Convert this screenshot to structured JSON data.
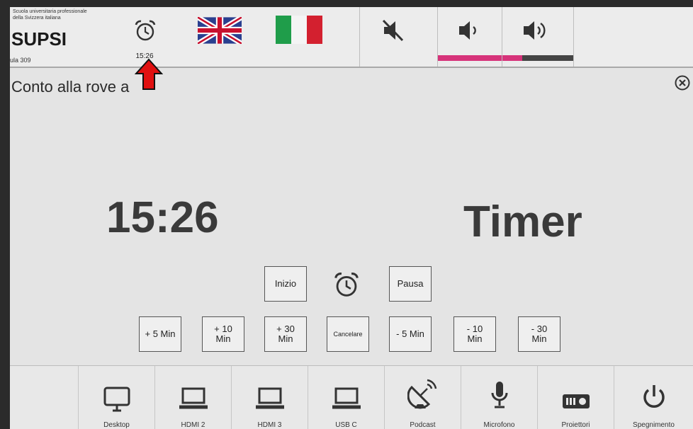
{
  "header": {
    "institution_line1": "Scuola universitaria professionale",
    "institution_line2": "della Svizzera italiana",
    "brand": "SUPSI",
    "room": "ula 309",
    "clock_time": "15:26"
  },
  "languages": [
    "english-flag",
    "italian-flag"
  ],
  "audio": {
    "mute_icon": "speaker-mute-icon",
    "vol_down_icon": "speaker-low-icon",
    "vol_up_icon": "speaker-high-icon",
    "vol_down_color": "#d6337a",
    "vol_up_color": "#444444"
  },
  "page": {
    "title": "Conto alla rove   a",
    "big_time": "15:26",
    "big_label": "Timer"
  },
  "controls": {
    "start": "Inizio",
    "pause": "Pausa",
    "adjust": [
      {
        "l1": "+ 5 Min",
        "l2": ""
      },
      {
        "l1": "+ 10",
        "l2": "Min"
      },
      {
        "l1": "+ 30",
        "l2": "Min"
      },
      {
        "l1": "Cancelare",
        "l2": ""
      },
      {
        "l1": "- 5 Min",
        "l2": ""
      },
      {
        "l1": "- 10",
        "l2": "Min"
      },
      {
        "l1": "- 30",
        "l2": "Min"
      }
    ]
  },
  "sources": [
    {
      "label": "Desktop",
      "icon": "monitor-icon"
    },
    {
      "label": "HDMI 2",
      "icon": "laptop-icon"
    },
    {
      "label": "HDMI 3",
      "icon": "laptop-icon"
    },
    {
      "label": "USB C",
      "icon": "laptop-icon"
    },
    {
      "label": "Podcast",
      "icon": "satellite-dish-icon"
    },
    {
      "label": "Microfono",
      "icon": "microphone-icon"
    },
    {
      "label": "Proiettori",
      "icon": "projector-icon"
    },
    {
      "label": "Spegnimento",
      "icon": "power-icon"
    }
  ]
}
